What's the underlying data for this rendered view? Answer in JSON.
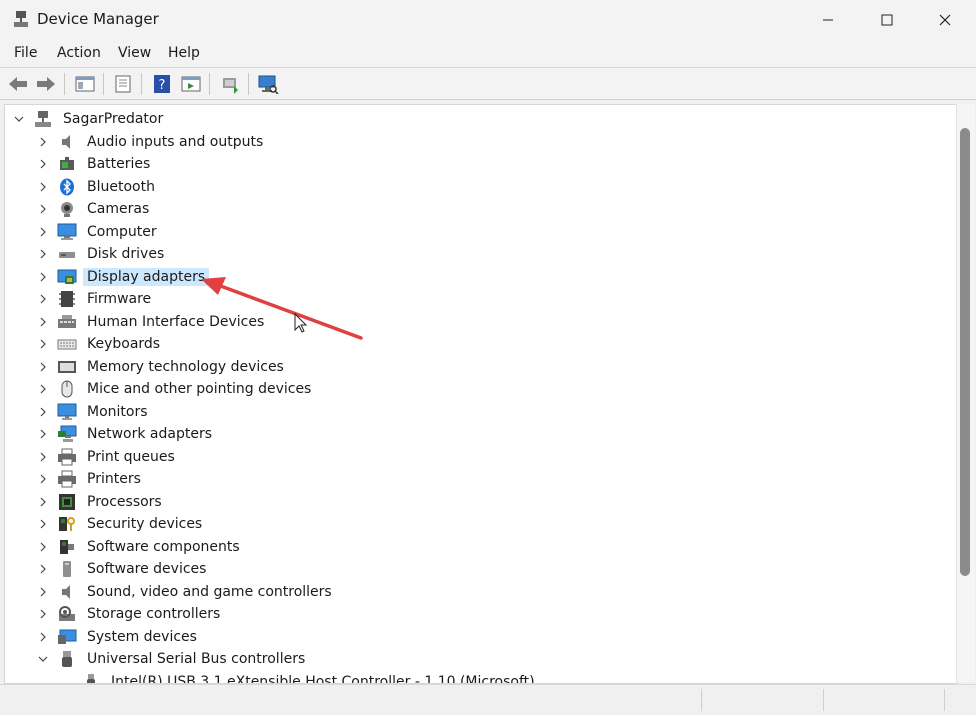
{
  "window": {
    "title": "Device Manager"
  },
  "menu": [
    "File",
    "Action",
    "View",
    "Help"
  ],
  "toolbar_icons": [
    "back-arrow-icon",
    "forward-arrow-icon",
    "show-hide-console-tree-icon",
    "properties-icon",
    "help-icon",
    "action-pane-icon",
    "update-driver-icon",
    "scan-hardware-icon"
  ],
  "tree": {
    "root": "SagarPredator",
    "items": [
      {
        "label": "Audio inputs and outputs",
        "icon": "speaker-icon"
      },
      {
        "label": "Batteries",
        "icon": "battery-icon"
      },
      {
        "label": "Bluetooth",
        "icon": "bluetooth-icon"
      },
      {
        "label": "Cameras",
        "icon": "camera-icon"
      },
      {
        "label": "Computer",
        "icon": "computer-icon"
      },
      {
        "label": "Disk drives",
        "icon": "disk-drive-icon"
      },
      {
        "label": "Display adapters",
        "icon": "display-adapter-icon",
        "selected": true
      },
      {
        "label": "Firmware",
        "icon": "firmware-icon"
      },
      {
        "label": "Human Interface Devices",
        "icon": "hid-icon"
      },
      {
        "label": "Keyboards",
        "icon": "keyboard-icon"
      },
      {
        "label": "Memory technology devices",
        "icon": "memory-icon"
      },
      {
        "label": "Mice and other pointing devices",
        "icon": "mouse-icon"
      },
      {
        "label": "Monitors",
        "icon": "monitor-icon"
      },
      {
        "label": "Network adapters",
        "icon": "network-adapter-icon"
      },
      {
        "label": "Print queues",
        "icon": "print-queue-icon"
      },
      {
        "label": "Printers",
        "icon": "printer-icon"
      },
      {
        "label": "Processors",
        "icon": "processor-icon"
      },
      {
        "label": "Security devices",
        "icon": "security-device-icon"
      },
      {
        "label": "Software components",
        "icon": "software-component-icon"
      },
      {
        "label": "Software devices",
        "icon": "software-device-icon"
      },
      {
        "label": "Sound, video and game controllers",
        "icon": "sound-controller-icon"
      },
      {
        "label": "Storage controllers",
        "icon": "storage-controller-icon"
      },
      {
        "label": "System devices",
        "icon": "system-device-icon"
      },
      {
        "label": "Universal Serial Bus controllers",
        "icon": "usb-icon",
        "expanded": true
      }
    ],
    "child_items": [
      {
        "label": "Intel(R) USB 3.1 eXtensible Host Controller - 1.10 (Microsoft)",
        "icon": "usb-device-icon"
      }
    ]
  },
  "colors": {
    "selection": "#cce8ff",
    "annotation_arrow": "#e04040",
    "accent": "#0078d4"
  }
}
